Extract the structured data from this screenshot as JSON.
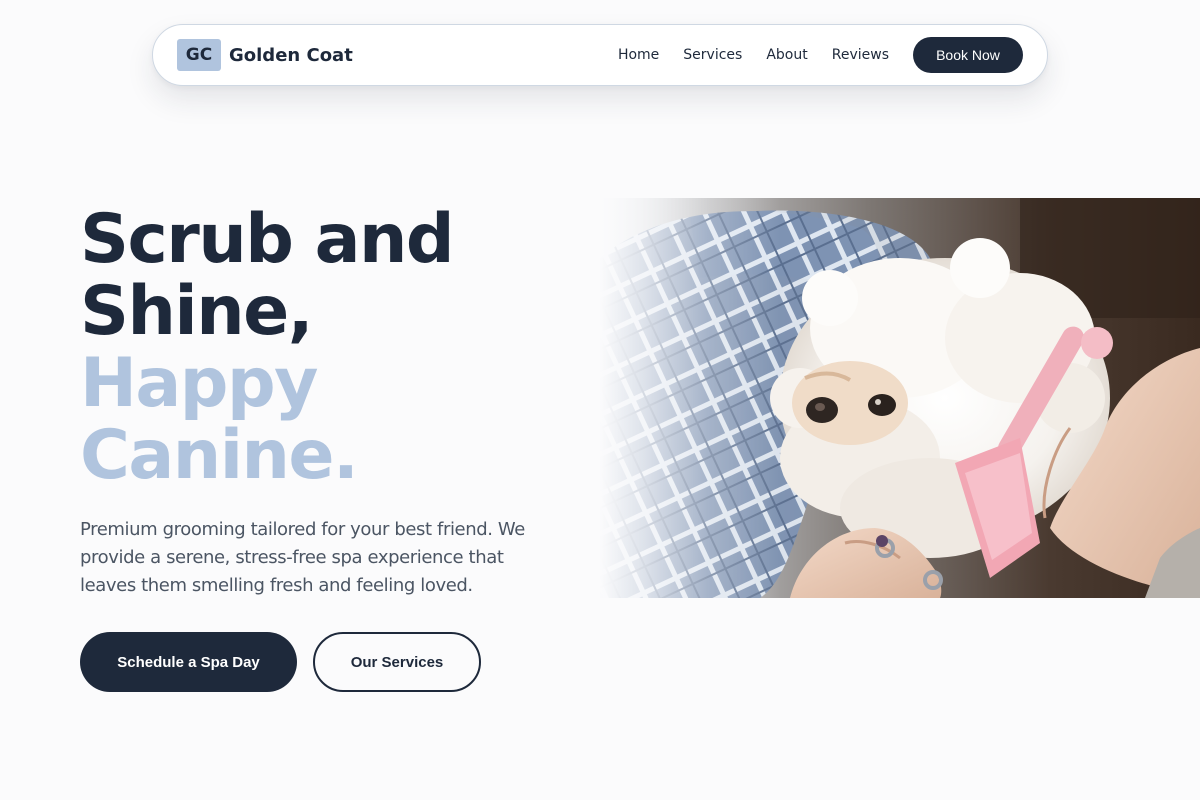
{
  "brand": {
    "initials": "GC",
    "name": "Golden Coat"
  },
  "nav": {
    "links": [
      "Home",
      "Services",
      "About",
      "Reviews"
    ],
    "cta": "Book Now"
  },
  "hero": {
    "title_line1": "Scrub and",
    "title_line2": "Shine,",
    "title_line3": "Happy",
    "title_line4": "Canine.",
    "description": "Premium grooming tailored for your best friend. We provide a serene, stress-free spa experience that leaves them smelling fresh and feeling loved.",
    "primary_button": "Schedule a Spa Day",
    "secondary_button": "Our Services"
  },
  "colors": {
    "primary": "#1e293b",
    "accent": "#b0c4de",
    "background": "#fbfbfc"
  }
}
